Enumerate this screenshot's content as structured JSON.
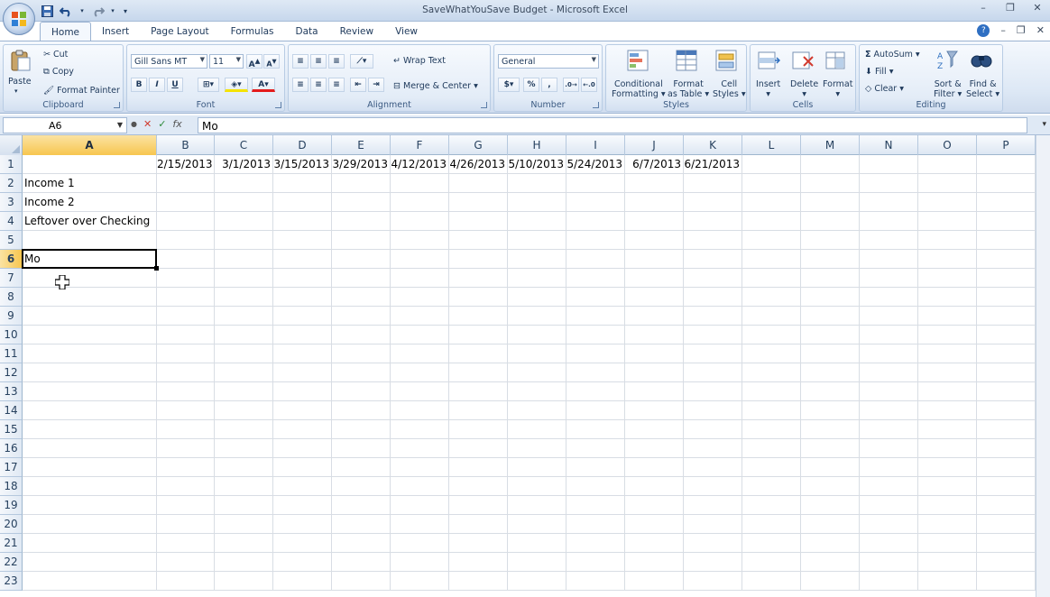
{
  "window": {
    "title": "SaveWhatYouSave Budget - Microsoft Excel",
    "controls": [
      "–",
      "❐",
      "✕"
    ],
    "ribbon_controls": [
      "–",
      "❐",
      "✕"
    ]
  },
  "quick_access": {
    "items": [
      "save-icon",
      "undo-icon",
      "redo-icon",
      "customize-icon"
    ]
  },
  "tabs": [
    {
      "label": "Home",
      "active": true
    },
    {
      "label": "Insert"
    },
    {
      "label": "Page Layout"
    },
    {
      "label": "Formulas"
    },
    {
      "label": "Data"
    },
    {
      "label": "Review"
    },
    {
      "label": "View"
    }
  ],
  "ribbon": {
    "clipboard": {
      "label": "Clipboard",
      "paste": "Paste",
      "cut": "Cut",
      "copy": "Copy",
      "format_painter": "Format Painter"
    },
    "font": {
      "label": "Font",
      "font_name": "Gill Sans MT",
      "font_size": "11",
      "bold": "B",
      "italic": "I",
      "underline": "U"
    },
    "alignment": {
      "label": "Alignment",
      "wrap_text": "Wrap Text",
      "merge_center": "Merge & Center"
    },
    "number": {
      "label": "Number",
      "format": "General",
      "currency": "$",
      "percent": "%",
      "comma": ","
    },
    "styles": {
      "label": "Styles",
      "conditional_1": "Conditional",
      "conditional_2": "Formatting",
      "format_table_1": "Format",
      "format_table_2": "as Table",
      "cell_styles_1": "Cell",
      "cell_styles_2": "Styles"
    },
    "cells": {
      "label": "Cells",
      "insert": "Insert",
      "delete": "Delete",
      "format": "Format"
    },
    "editing": {
      "label": "Editing",
      "autosum": "AutoSum",
      "fill": "Fill",
      "clear": "Clear",
      "sort_1": "Sort &",
      "sort_2": "Filter",
      "find_1": "Find &",
      "find_2": "Select"
    }
  },
  "formula_bar": {
    "name_box": "A6",
    "content": "Mo"
  },
  "sheet": {
    "columns": [
      "A",
      "B",
      "C",
      "D",
      "E",
      "F",
      "G",
      "H",
      "I",
      "J",
      "K",
      "L",
      "M",
      "N",
      "O",
      "P"
    ],
    "selected_column": "A",
    "rows": [
      "1",
      "2",
      "3",
      "4",
      "5",
      "6",
      "7",
      "8",
      "9",
      "10",
      "11",
      "12",
      "13",
      "14",
      "15",
      "16",
      "17",
      "18",
      "19",
      "20",
      "21",
      "22",
      "23"
    ],
    "selected_row": "6",
    "dates": [
      "2/15/2013",
      "3/1/2013",
      "3/15/2013",
      "3/29/2013",
      "4/12/2013",
      "4/26/2013",
      "5/10/2013",
      "5/24/2013",
      "6/7/2013",
      "6/21/2013"
    ],
    "row_labels": {
      "r2": "Income 1",
      "r3": "Income 2",
      "r4": "Leftover over Checking",
      "r6": "Mo"
    },
    "active_cell": "A6"
  }
}
